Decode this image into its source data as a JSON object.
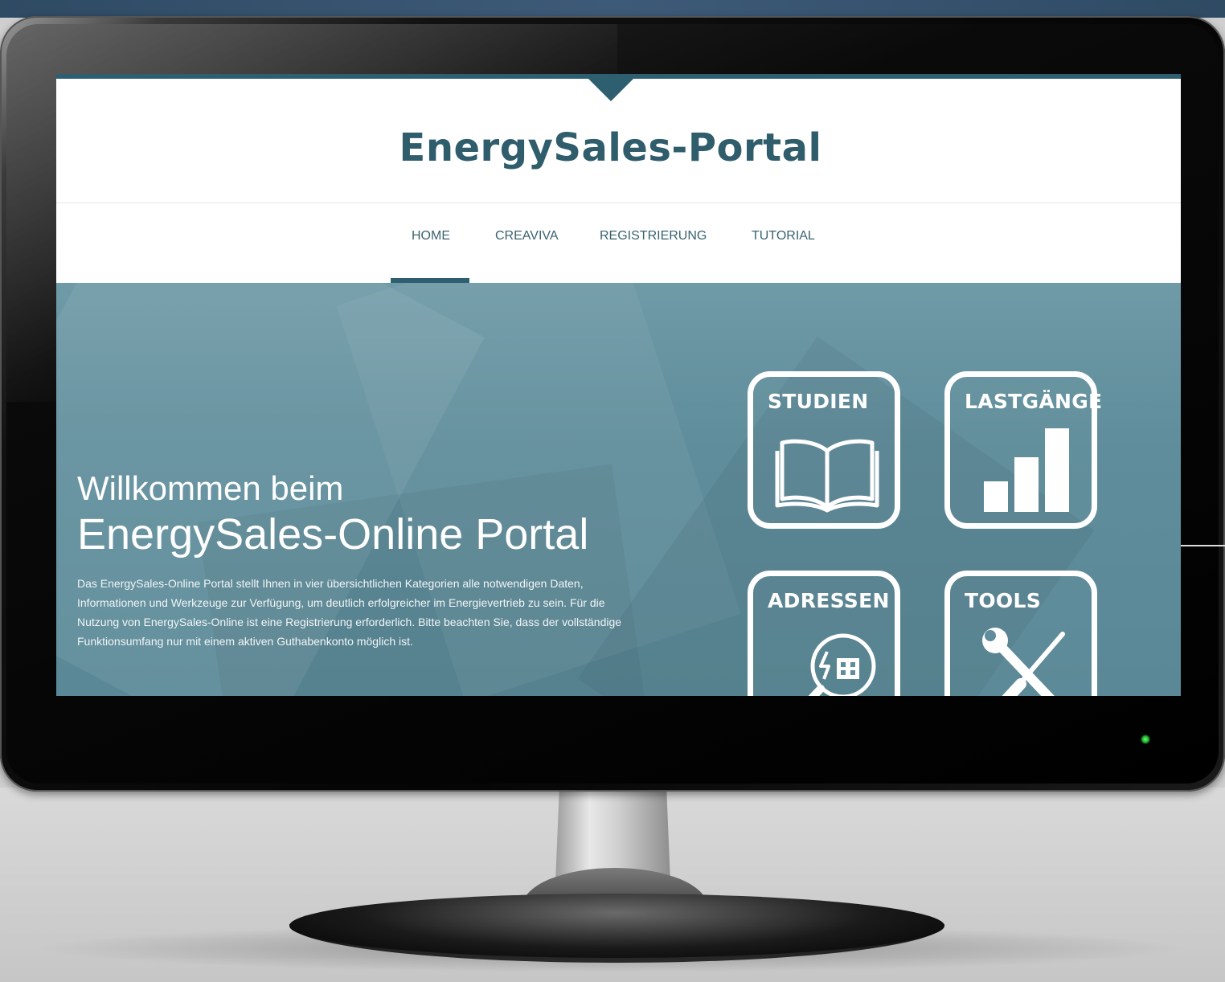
{
  "site": {
    "title": "EnergySales-Portal"
  },
  "nav": {
    "items": [
      {
        "label": "HOME",
        "active": true
      },
      {
        "label": "CREAVIVA",
        "active": false
      },
      {
        "label": "REGISTRIERUNG",
        "active": false
      },
      {
        "label": "TUTORIAL",
        "active": false
      }
    ]
  },
  "hero": {
    "welcome_line1": "Willkommen beim",
    "welcome_line2": "EnergySales-Online Portal",
    "intro": "Das EnergySales-Online Portal stellt Ihnen in vier übersichtlichen Kategorien alle notwendigen Daten, Informationen und Werkzeuge zur Verfügung, um deutlich erfolgreicher im Energievertrieb zu sein. Für die Nutzung von EnergySales-Online ist eine Registrierung erforderlich. Bitte beachten Sie, dass der vollständige Funktionsumfang nur mit einem aktiven Guthabenkonto möglich ist."
  },
  "tiles": [
    {
      "label": "STUDIEN",
      "icon": "book-icon"
    },
    {
      "label": "LASTGÄNGE",
      "icon": "bar-chart-icon"
    },
    {
      "label": "ADRESSEN",
      "icon": "magnifier-energy-icon"
    },
    {
      "label": "TOOLS",
      "icon": "tools-icon"
    }
  ],
  "colors": {
    "brand": "#2d5f70",
    "hero": "#5f8d9b",
    "power_led": "#1fae2b"
  }
}
